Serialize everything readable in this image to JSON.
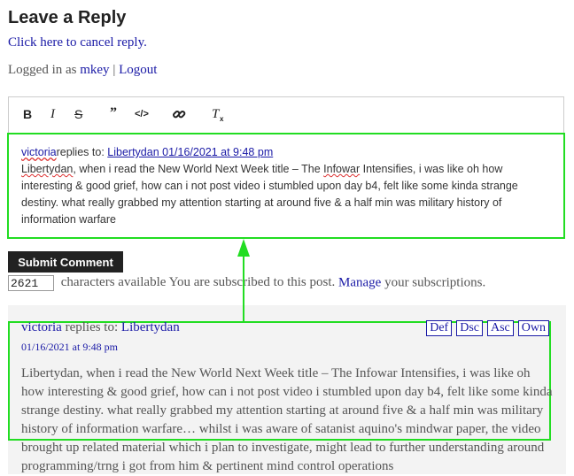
{
  "heading": "Leave a Reply",
  "cancel_link": "Click here to cancel reply.",
  "logged_in": {
    "prefix": "Logged in as",
    "user": "mkey",
    "sep": "|",
    "logout": "Logout"
  },
  "toolbar": {
    "bold": "B",
    "italic": "I",
    "strike": "S",
    "quote": "99",
    "code": "</>",
    "link": "link-icon",
    "clear": "clear-format-icon"
  },
  "editor": {
    "author": "victoria",
    "replies_to": "replies to:",
    "reply_link": "Libertydan 01/16/2021 at 9:48 pm",
    "author_name_underlined": "Libertydan",
    "body_after": ", when i read the New World Next Week title – The",
    "infowar": "Infowar",
    "body_rest": " Intensifies, i was like oh how interesting & good grief, how can i not post video i stumbled upon day b4, felt like some kinda strange destiny. what really grabbed my attention starting at around five & a half min was military history of information warfare"
  },
  "submit_label": "Submit Comment",
  "counter": {
    "value": "2621",
    "text": "characters available You are subscribed to this post.",
    "manage": "Manage",
    "tail": "your subscriptions."
  },
  "comment": {
    "author": "victoria",
    "replies_to": "replies to:",
    "target": "Libertydan",
    "date": "01/16/2021 at 9:48 pm",
    "buttons": [
      "Def",
      "Dsc",
      "Asc",
      "Own"
    ],
    "text": "Libertydan, when i read the New World Next Week title – The Infowar Intensifies, i was like oh how interesting & good grief, how can i not post video i stumbled upon day b4, felt like some kinda strange destiny. what really grabbed my attention starting at around five & a half min was military history of information warfare… whilst i was aware of satanist aquino's mindwar paper, the video brought up related material which i plan to investigate, might lead to further understanding around programming/trng i got from him & pertinent mind control operations"
  },
  "colors": {
    "highlight": "#22dd22",
    "link": "#1a1aa6"
  }
}
